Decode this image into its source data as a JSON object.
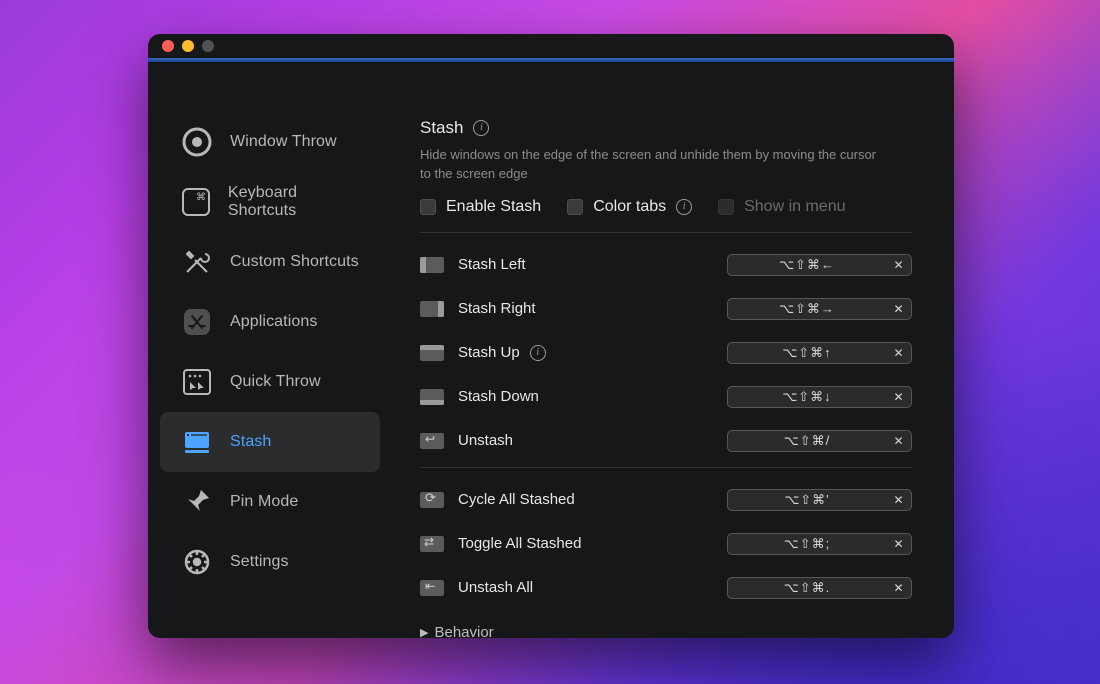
{
  "sidebar": {
    "items": [
      {
        "label": "Window Throw"
      },
      {
        "label": "Keyboard Shortcuts"
      },
      {
        "label": "Custom Shortcuts"
      },
      {
        "label": "Applications"
      },
      {
        "label": "Quick Throw"
      },
      {
        "label": "Stash"
      },
      {
        "label": "Pin Mode"
      },
      {
        "label": "Settings"
      }
    ]
  },
  "panel": {
    "title": "Stash",
    "description": "Hide windows on the edge of the screen and unhide them by moving the cursor to the screen edge",
    "options": {
      "enable_label": "Enable Stash",
      "color_tabs_label": "Color tabs",
      "show_in_menu_label": "Show in menu"
    },
    "shortcuts_a": [
      {
        "label": "Stash Left",
        "keys": "⌥⇧⌘←",
        "icon": "stash-left",
        "info": false
      },
      {
        "label": "Stash Right",
        "keys": "⌥⇧⌘→",
        "icon": "stash-right",
        "info": false
      },
      {
        "label": "Stash Up",
        "keys": "⌥⇧⌘↑",
        "icon": "stash-up",
        "info": true
      },
      {
        "label": "Stash Down",
        "keys": "⌥⇧⌘↓",
        "icon": "stash-down",
        "info": false
      },
      {
        "label": "Unstash",
        "keys": "⌥⇧⌘/",
        "icon": "unstash",
        "info": false
      }
    ],
    "shortcuts_b": [
      {
        "label": "Cycle All Stashed",
        "keys": "⌥⇧⌘'",
        "icon": "cycle",
        "info": false
      },
      {
        "label": "Toggle All Stashed",
        "keys": "⌥⇧⌘;",
        "icon": "toggle",
        "info": false
      },
      {
        "label": "Unstash All",
        "keys": "⌥⇧⌘.",
        "icon": "unstash-all",
        "info": false
      }
    ],
    "behavior_label": "Behavior",
    "clear_glyph": "✕"
  }
}
